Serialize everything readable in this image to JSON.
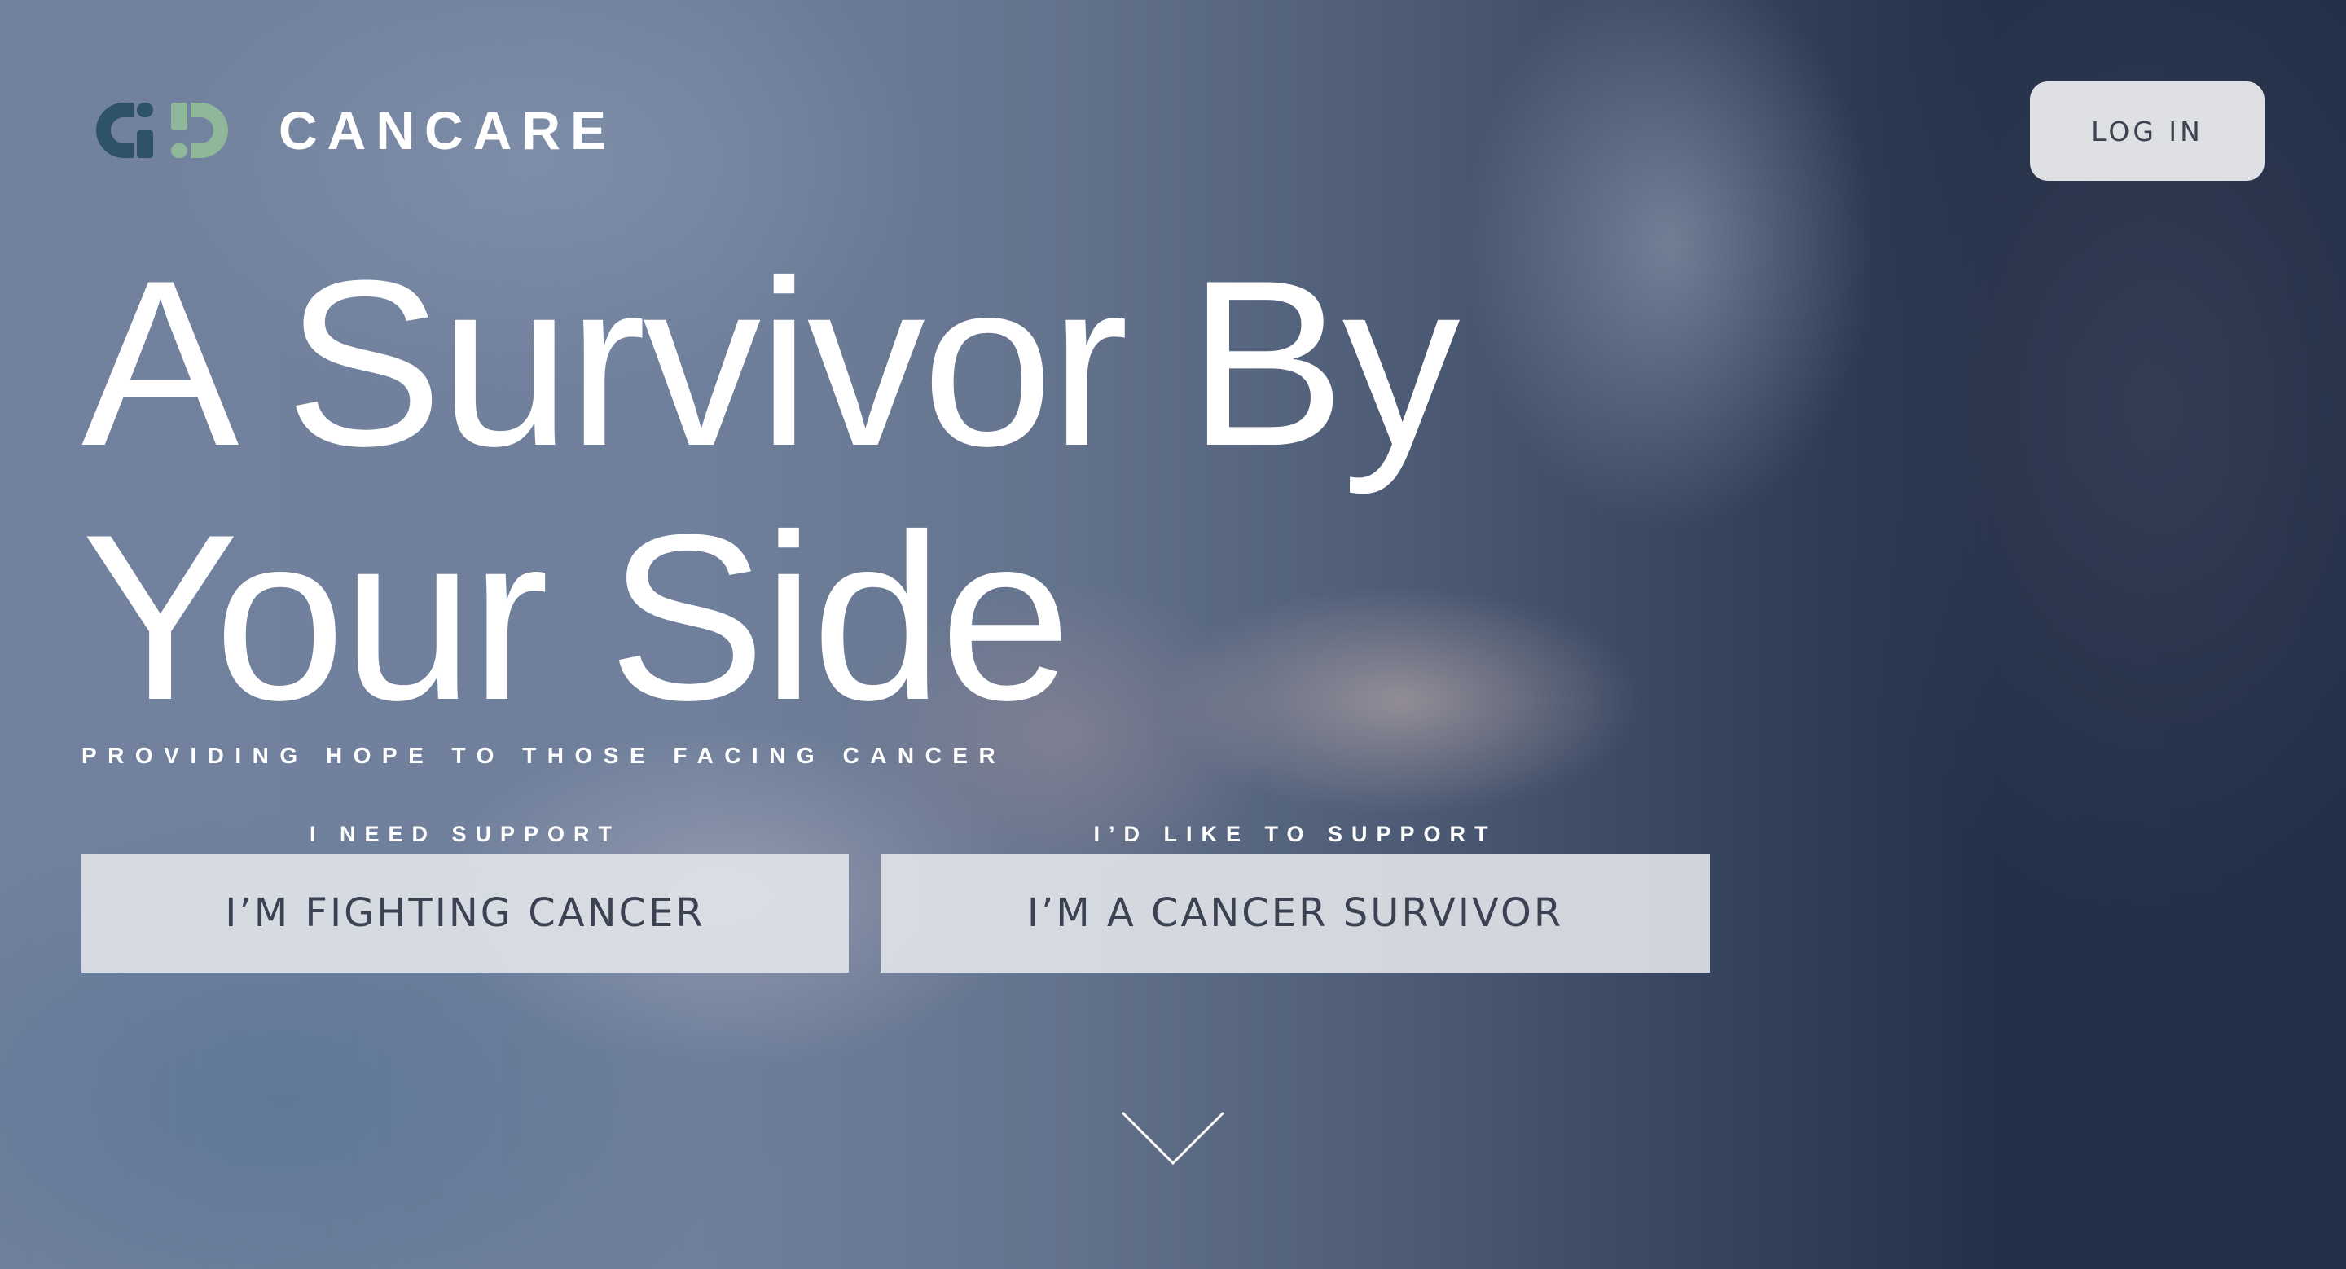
{
  "header": {
    "brand_name": "CANCARE",
    "logo_icon": "cancare-logo-icon",
    "login_label": "LOG IN"
  },
  "hero": {
    "headline": "A Survivor By Your Side",
    "tagline": "PROVIDING HOPE TO THOSE FACING CANCER",
    "scroll_icon": "chevron-down-icon"
  },
  "cta": [
    {
      "label": "I NEED SUPPORT",
      "button": "I’M FIGHTING CANCER"
    },
    {
      "label": "I’D LIKE TO SUPPORT",
      "button": "I’M A CANCER SURVIVOR"
    }
  ],
  "colors": {
    "logo_dark": "#2e5366",
    "logo_light": "#8fb89a",
    "button_bg": "#dfe0e4",
    "button_text": "#3b4252",
    "background": "#26344a"
  }
}
